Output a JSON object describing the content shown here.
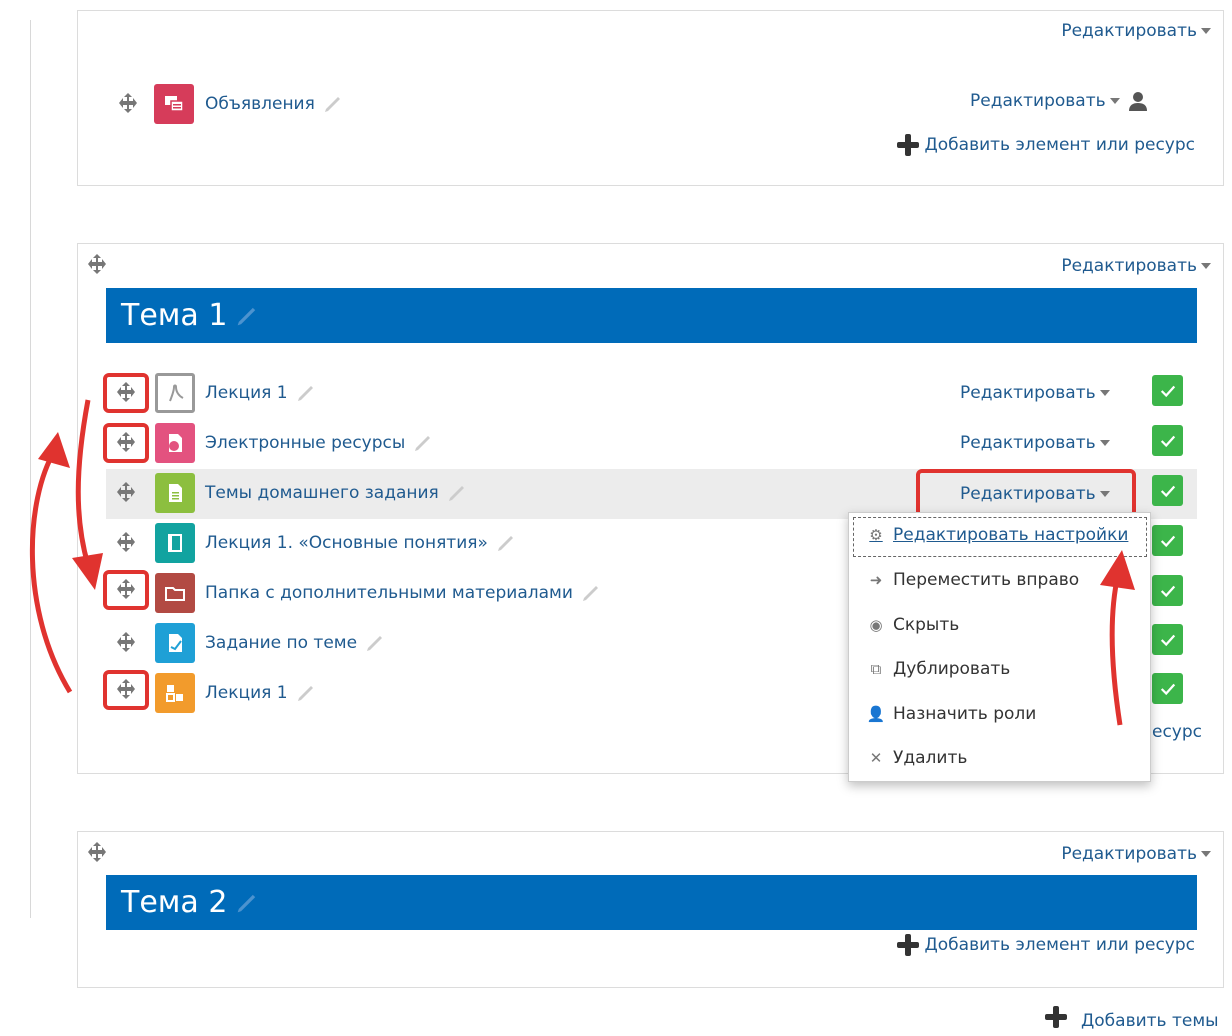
{
  "section0": {
    "edit_label": "Редактировать",
    "activity": {
      "name": "Объявления",
      "icon": "forum-icon",
      "edit_label": "Редактировать"
    },
    "add_label": "Добавить элемент или ресурс"
  },
  "topic1": {
    "title": "Тема 1",
    "edit_label": "Редактировать",
    "activities": [
      {
        "name": "Лекция 1",
        "icon": "pdf-icon",
        "color": "#ffffff",
        "edit_label": "Редактировать"
      },
      {
        "name": "Электронные ресурсы",
        "icon": "url-icon",
        "color": "#e3527f",
        "edit_label": "Редактировать"
      },
      {
        "name": "Темы домашнего задания",
        "icon": "page-icon",
        "color": "#8cbf3f",
        "edit_label": "Редактировать"
      },
      {
        "name": "Лекция 1. «Основные понятия»",
        "icon": "book-icon",
        "color": "#12a3a0"
      },
      {
        "name": "Папка с дополнительными материалами",
        "icon": "folder-icon",
        "color": "#b24a43"
      },
      {
        "name": "Задание по теме",
        "icon": "assignment-icon",
        "color": "#1fa0d6"
      },
      {
        "name": "Лекция 1",
        "icon": "scorm-icon",
        "color": "#f29b2c"
      }
    ],
    "add_label_partial": "есурс"
  },
  "menu": {
    "items": [
      {
        "label": "Редактировать настройки",
        "icon": "gear-icon"
      },
      {
        "label": "Переместить вправо",
        "icon": "arrow-right-icon"
      },
      {
        "label": "Скрыть",
        "icon": "eye-icon"
      },
      {
        "label": "Дублировать",
        "icon": "copy-icon"
      },
      {
        "label": "Назначить роли",
        "icon": "user-plus-icon"
      },
      {
        "label": "Удалить",
        "icon": "close-icon"
      }
    ]
  },
  "topic2": {
    "title": "Тема 2",
    "edit_label": "Редактировать",
    "add_label": "Добавить элемент или ресурс"
  },
  "add_topics_label": "Добавить темы",
  "colors": {
    "topic_bar": "#006bb9",
    "link": "#1f5a8f",
    "highlight": "#e0332f",
    "check": "#3cb54a"
  }
}
